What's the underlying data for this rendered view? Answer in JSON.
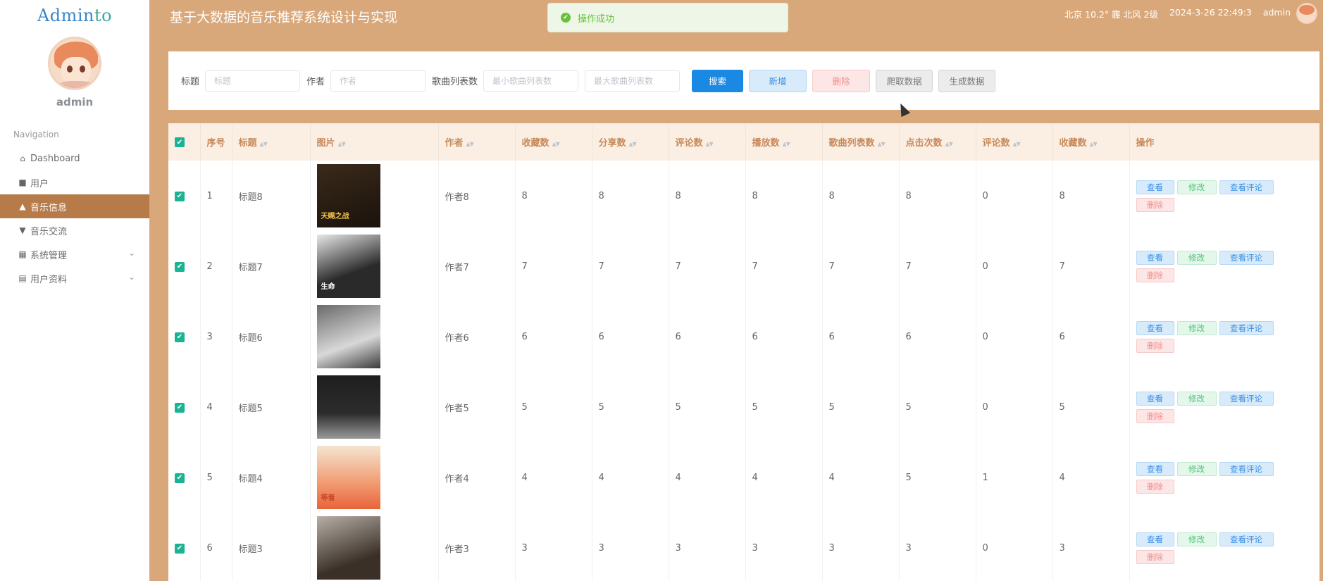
{
  "brand": {
    "part1": "Admin",
    "part2": "to"
  },
  "user": {
    "name": "admin"
  },
  "nav": {
    "label": "Navigation",
    "items": [
      {
        "label": "Dashboard",
        "icon": "home-icon"
      },
      {
        "label": "用户",
        "icon": "user-icon"
      },
      {
        "label": "音乐信息",
        "icon": "music-icon"
      },
      {
        "label": "音乐交流",
        "icon": "chat-icon"
      },
      {
        "label": "系统管理",
        "icon": "grid-icon"
      },
      {
        "label": "用户资料",
        "icon": "profile-icon"
      }
    ]
  },
  "header": {
    "title": "基于大数据的音乐推荐系统设计与实现",
    "weather": "北京  10.2°  霾  北风  2级",
    "datetime": "2024-3-26 22:49:3",
    "user": "admin"
  },
  "toast": {
    "message": "操作成功"
  },
  "search": {
    "title_label": "标题",
    "title_placeholder": "标题",
    "author_label": "作者",
    "author_placeholder": "作者",
    "count_label": "歌曲列表数",
    "min_placeholder": "最小歌曲列表数",
    "max_placeholder": "最大歌曲列表数",
    "btn_search": "搜索",
    "btn_add": "新增",
    "btn_delete": "删除",
    "btn_crawl": "爬取数据",
    "btn_generate": "生成数据"
  },
  "table": {
    "headers": [
      "序号",
      "标题",
      "图片",
      "作者",
      "收藏数",
      "分享数",
      "评论数",
      "播放数",
      "歌曲列表数",
      "点击次数",
      "评论数",
      "收藏数",
      "操作"
    ],
    "ops": {
      "view": "查看",
      "edit": "修改",
      "comments": "查看评论",
      "delete": "删除"
    },
    "rows": [
      {
        "idx": "1",
        "title": "标题8",
        "author": "作者8",
        "fav": "8",
        "share": "8",
        "comment": "8",
        "play": "8",
        "list": "8",
        "clicks": "8",
        "comment2": "0",
        "fav2": "8",
        "cover_text": "天赐之战"
      },
      {
        "idx": "2",
        "title": "标题7",
        "author": "作者7",
        "fav": "7",
        "share": "7",
        "comment": "7",
        "play": "7",
        "list": "7",
        "clicks": "7",
        "comment2": "0",
        "fav2": "7",
        "cover_text": "生命"
      },
      {
        "idx": "3",
        "title": "标题6",
        "author": "作者6",
        "fav": "6",
        "share": "6",
        "comment": "6",
        "play": "6",
        "list": "6",
        "clicks": "6",
        "comment2": "0",
        "fav2": "6",
        "cover_text": ""
      },
      {
        "idx": "4",
        "title": "标题5",
        "author": "作者5",
        "fav": "5",
        "share": "5",
        "comment": "5",
        "play": "5",
        "list": "5",
        "clicks": "5",
        "comment2": "0",
        "fav2": "5",
        "cover_text": ""
      },
      {
        "idx": "5",
        "title": "标题4",
        "author": "作者4",
        "fav": "4",
        "share": "4",
        "comment": "4",
        "play": "4",
        "list": "4",
        "clicks": "5",
        "comment2": "1",
        "fav2": "4",
        "cover_text": "等着"
      },
      {
        "idx": "6",
        "title": "标题3",
        "author": "作者3",
        "fav": "3",
        "share": "3",
        "comment": "3",
        "play": "3",
        "list": "3",
        "clicks": "3",
        "comment2": "0",
        "fav2": "3",
        "cover_text": ""
      }
    ]
  },
  "colors": {
    "accent": "#b67b49",
    "header_bg": "#d9a87a",
    "primary": "#1989e3",
    "check": "#1ab394"
  }
}
